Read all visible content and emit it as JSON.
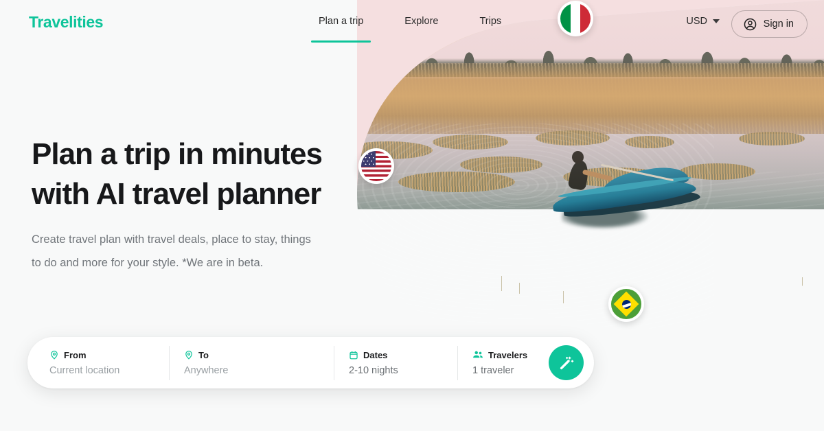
{
  "brand": {
    "name": "Travelities",
    "accent_color": "#0ec49a"
  },
  "header": {
    "nav": [
      {
        "label": "Plan a trip",
        "active": true
      },
      {
        "label": "Explore",
        "active": false
      },
      {
        "label": "Trips",
        "active": false
      }
    ],
    "currency": {
      "label": "USD",
      "icon": "chevron-down-icon"
    },
    "signin": {
      "label": "Sign in",
      "icon": "account-circle-icon"
    }
  },
  "hero": {
    "headline_line1": "Plan a trip in minutes",
    "headline_line2": "with AI travel planner",
    "subhead_line1": "Create travel plan with travel deals, place to stay, things",
    "subhead_line2": "to do and more for your style. *We are in beta.",
    "image_alt": "Man paddling a blue wooden boat across a calm lake with golden reed islands at dusk",
    "background_color": "#f5dfe0"
  },
  "flags": [
    {
      "name": "italy-flag-badge",
      "country": "Italy"
    },
    {
      "name": "usa-flag-badge",
      "country": "United States"
    },
    {
      "name": "brazil-flag-badge",
      "country": "Brazil"
    }
  ],
  "search": {
    "from": {
      "label": "From",
      "value": "Current location",
      "icon": "location-pin-icon"
    },
    "to": {
      "label": "To",
      "value": "Anywhere",
      "icon": "location-pin-icon"
    },
    "dates": {
      "label": "Dates",
      "value": "2-10 nights",
      "icon": "calendar-icon"
    },
    "travelers": {
      "label": "Travelers",
      "value": "1 traveler",
      "icon": "people-icon"
    },
    "submit": {
      "icon": "magic-wand-icon"
    }
  }
}
